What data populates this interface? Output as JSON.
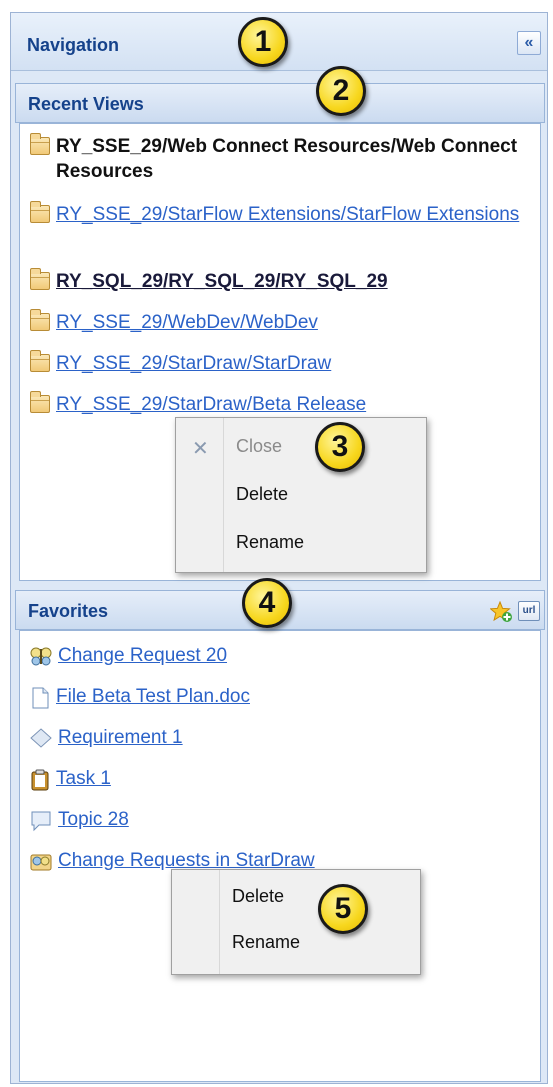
{
  "navigation": {
    "title": "Navigation",
    "collapse_label": "«"
  },
  "recent_views": {
    "title": "Recent Views",
    "items": [
      {
        "label": "RY_SSE_29/Web Connect Resources/Web Connect Resources",
        "style": "bold"
      },
      {
        "label": "RY_SSE_29/StarFlow Extensions/StarFlow Extensions",
        "style": "link"
      },
      {
        "label": "RY_SQL_29/RY_SQL_29/RY_SQL_29",
        "style": "bold-link"
      },
      {
        "label": "RY_SSE_29/WebDev/WebDev",
        "style": "link"
      },
      {
        "label": "RY_SSE_29/StarDraw/StarDraw",
        "style": "link"
      },
      {
        "label": "RY_SSE_29/StarDraw/Beta Release",
        "style": "link"
      }
    ],
    "context_menu": {
      "items": [
        {
          "label": "Close",
          "disabled": true,
          "icon": "close-x-icon"
        },
        {
          "label": "Delete",
          "disabled": false
        },
        {
          "label": "Rename",
          "disabled": false
        }
      ]
    }
  },
  "favorites": {
    "title": "Favorites",
    "tools": {
      "add_icon": "add-favorite-star-icon",
      "url_label": "url"
    },
    "items": [
      {
        "label": "Change Request 20",
        "icon": "change-request-icon"
      },
      {
        "label": "File Beta Test Plan.doc",
        "icon": "document-icon"
      },
      {
        "label": "Requirement 1",
        "icon": "requirement-icon"
      },
      {
        "label": "Task 1",
        "icon": "task-icon"
      },
      {
        "label": "Topic 28",
        "icon": "topic-icon"
      },
      {
        "label": "Change Requests in StarDraw",
        "icon": "query-folder-icon"
      }
    ],
    "context_menu": {
      "items": [
        {
          "label": "Delete",
          "disabled": false
        },
        {
          "label": "Rename",
          "disabled": false
        }
      ]
    }
  },
  "callouts": [
    "1",
    "2",
    "3",
    "4",
    "5"
  ],
  "colors": {
    "header_text": "#15428b",
    "link": "#2b62c8",
    "callout_fill": "#f7d71e"
  }
}
